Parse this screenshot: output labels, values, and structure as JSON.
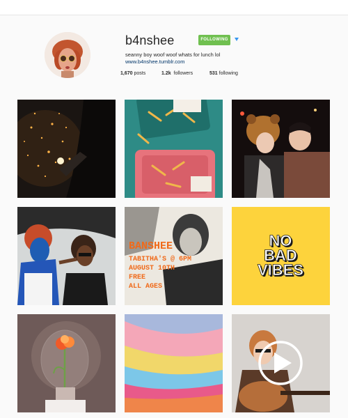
{
  "profile": {
    "username": "b4nshee",
    "follow_label": "FOLLOWING",
    "bio": "seanny boy woof woof whats for lunch lol",
    "link": "www.b4nshee.tumblr.com",
    "stats": {
      "posts_value": "1,670",
      "posts_label": "posts",
      "followers_value": "1.2k",
      "followers_label": "followers",
      "following_value": "531",
      "following_label": "following"
    }
  },
  "posts": [
    {
      "name": "sparkler",
      "alt": "sparkler at night"
    },
    {
      "name": "fries-trays",
      "alt": "fries on teal and pink trays"
    },
    {
      "name": "friends-bear-hat",
      "alt": "two friends, one in a bear hat"
    },
    {
      "name": "face-paint",
      "alt": "blue face paint in car trunk"
    },
    {
      "name": "event-poster",
      "alt": "event poster"
    },
    {
      "name": "no-bad-vibes",
      "alt": "no bad vibes sign"
    },
    {
      "name": "light-bulb-rose",
      "alt": "rose inside a light bulb"
    },
    {
      "name": "paint-strokes",
      "alt": "colorful paint strokes"
    },
    {
      "name": "guitar-video",
      "alt": "guitar player video"
    }
  ],
  "poster": {
    "title": "BANSHEE",
    "line1": "TABITHA'S @ 6PM",
    "line2": "AUGUST 10TH",
    "line3": "FREE",
    "line4": "ALL AGES"
  },
  "sign": {
    "line1": "NO",
    "line2": "BAD",
    "line3": "VIBES"
  },
  "colors": {
    "follow_green": "#70c050",
    "link_blue": "#003569",
    "dropdown_blue": "#3897f0",
    "sign_yellow": "#fdd33c"
  }
}
